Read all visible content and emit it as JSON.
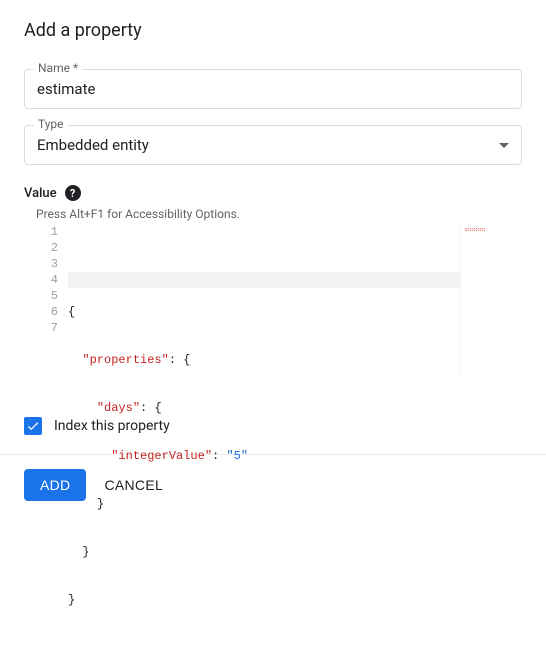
{
  "dialog": {
    "title": "Add a property"
  },
  "name_field": {
    "label": "Name *",
    "value": "estimate"
  },
  "type_field": {
    "label": "Type",
    "value": "Embedded entity"
  },
  "value_section": {
    "label": "Value",
    "accessibility_hint": "Press Alt+F1 for Accessibility Options."
  },
  "editor": {
    "line_numbers": [
      "1",
      "2",
      "3",
      "4",
      "5",
      "6",
      "7"
    ],
    "tokens": {
      "l1_open": "{",
      "l2_key": "\"properties\"",
      "l2_colon": ": ",
      "l2_open": "{",
      "l3_key": "\"days\"",
      "l3_colon": ": ",
      "l3_open": "{",
      "l4_key": "\"integerValue\"",
      "l4_colon": ": ",
      "l4_val": "\"5\"",
      "l5_close": "}",
      "l6_close": "}",
      "l7_close": "}"
    }
  },
  "index_checkbox": {
    "label": "Index this property",
    "checked": true
  },
  "buttons": {
    "add": "ADD",
    "cancel": "CANCEL"
  }
}
